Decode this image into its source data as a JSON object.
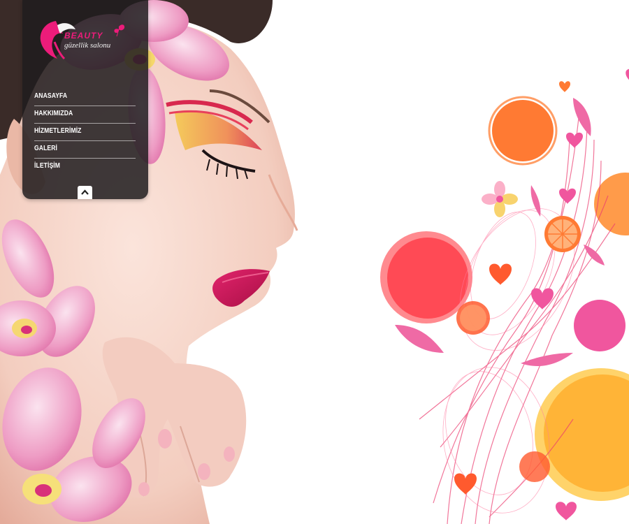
{
  "brand": {
    "name": "BEAUTY",
    "tagline": "güzellik salonu",
    "accent_color": "#ec1c7a"
  },
  "nav": {
    "items": [
      {
        "label": "ANASAYFA"
      },
      {
        "label": "HAKKIMIZDA"
      },
      {
        "label": "HİZMETLERİMİZ"
      },
      {
        "label": "GALERİ"
      },
      {
        "label": "İLETİŞİM"
      }
    ],
    "collapse_icon": "chevron-up-icon"
  },
  "hero": {
    "image": "woman-profile-with-orchids-and-colorful-circles",
    "colors": {
      "orange": "#ff7a33",
      "coral": "#ff4a55",
      "pink": "#f0569e",
      "yellow": "#ffb437",
      "orchid": "#e873b0",
      "lips": "#d6175c"
    }
  }
}
